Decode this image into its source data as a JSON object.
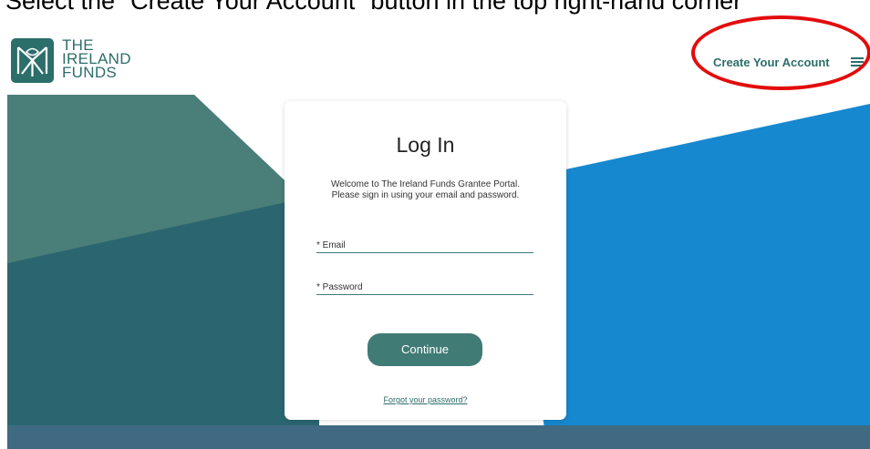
{
  "instruction": {
    "text": "Select the \"Create Your Account\" button in the top right-hand corner"
  },
  "header": {
    "logo_lines": [
      "THE",
      "IRELAND",
      "FUNDS"
    ],
    "create_account_label": "Create Your Account",
    "menu_icon": "hamburger-menu-icon"
  },
  "login": {
    "title": "Log In",
    "welcome_line1": "Welcome to The Ireland Funds Grantee Portal.",
    "welcome_line2": "Please sign in using your email and password.",
    "email_label": "* Email",
    "email_value": "",
    "password_label": "* Password",
    "password_value": "",
    "continue_label": "Continue",
    "forgot_label": "Forgot your password?"
  },
  "colors": {
    "brand_teal": "#2c6e6a",
    "button_teal": "#407b76",
    "hero_teal_light": "#4a7e78",
    "hero_teal_dark": "#2b6670",
    "hero_blue": "#1688cf",
    "footer_band": "#3f6a82",
    "annotation_red": "#e30c0c"
  }
}
